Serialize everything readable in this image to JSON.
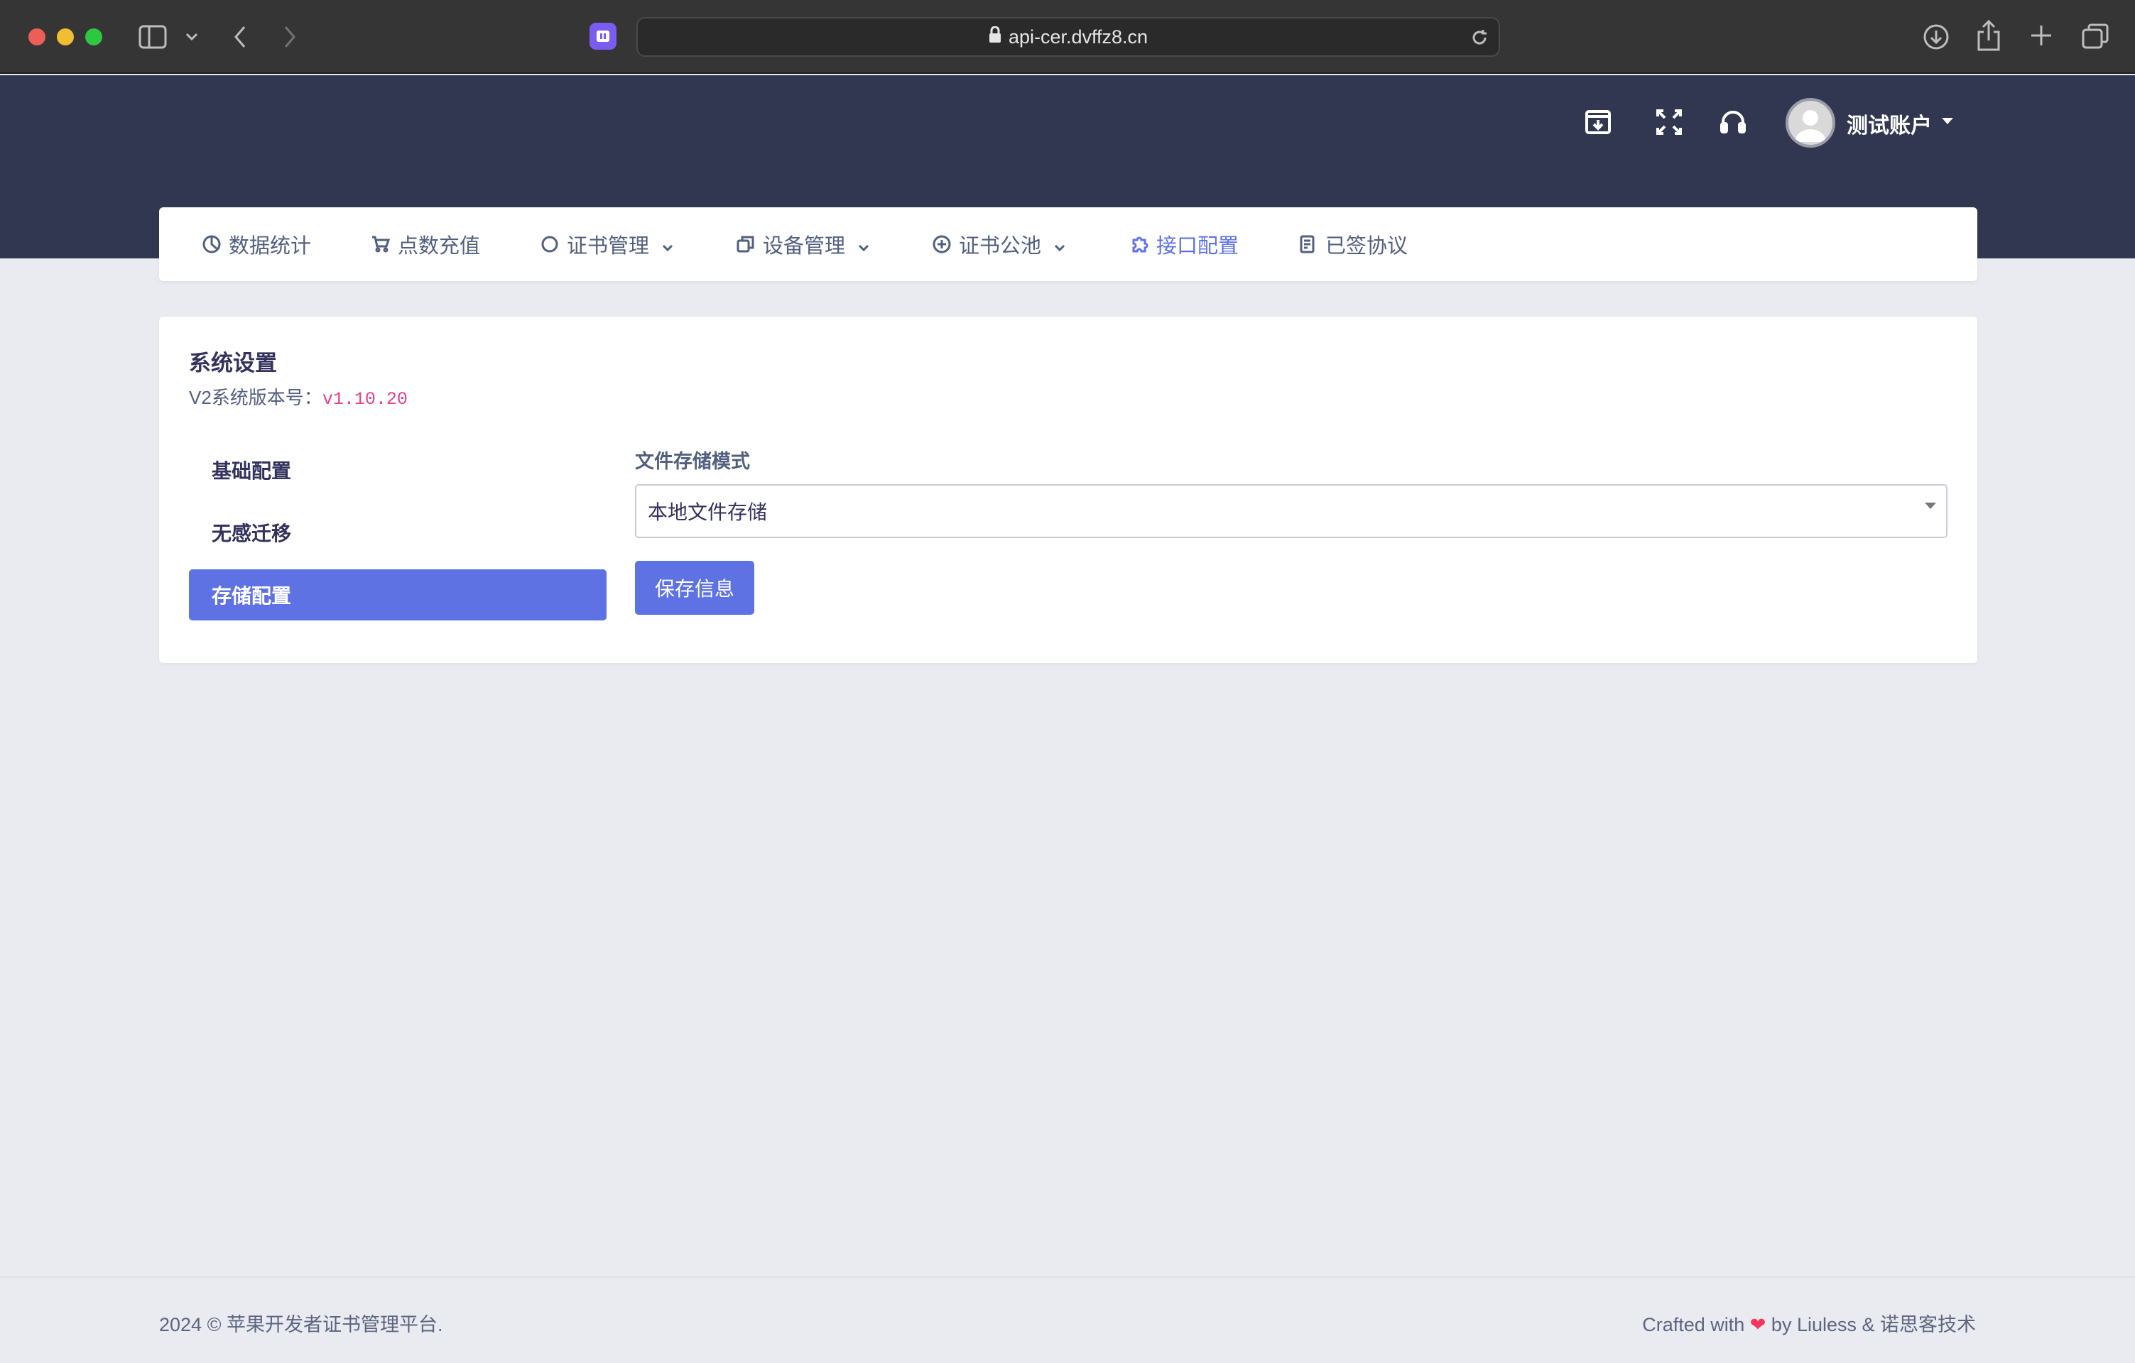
{
  "browser": {
    "url": "api-cer.dvffz8.cn",
    "icons": [
      "sidebar-toggle-icon",
      "chevron-down-icon",
      "back-icon",
      "forward-icon",
      "extension-icon",
      "lock-icon",
      "reload-icon",
      "download-icon",
      "share-icon",
      "new-tab-icon",
      "tab-overview-icon"
    ]
  },
  "header": {
    "icons": [
      "archive-download-icon",
      "fullscreen-icon",
      "headset-icon"
    ],
    "user_name": "测试账户"
  },
  "nav": {
    "items": [
      {
        "label": "数据统计",
        "icon": "pie-chart-icon",
        "dropdown": false,
        "active": false
      },
      {
        "label": "点数充值",
        "icon": "cart-icon",
        "dropdown": false,
        "active": false
      },
      {
        "label": "证书管理",
        "icon": "circle-icon",
        "dropdown": true,
        "active": false
      },
      {
        "label": "设备管理",
        "icon": "copy-icon",
        "dropdown": true,
        "active": false
      },
      {
        "label": "证书公池",
        "icon": "plus-circle-icon",
        "dropdown": true,
        "active": false
      },
      {
        "label": "接口配置",
        "icon": "puzzle-icon",
        "dropdown": false,
        "active": true
      },
      {
        "label": "已签协议",
        "icon": "document-icon",
        "dropdown": false,
        "active": false
      }
    ]
  },
  "card": {
    "title": "系统设置",
    "version_label": "V2系统版本号：",
    "version_value": "v1.10.20",
    "side_menu": [
      "基础配置",
      "无感迁移",
      "存储配置"
    ],
    "active_side": "存储配置",
    "field_label": "文件存储模式",
    "select_value": "本地文件存储",
    "save_label": "保存信息"
  },
  "footer": {
    "left": "2024 © 苹果开发者证书管理平台.",
    "right_prefix": "Crafted with",
    "right_suffix": "by Liuless & 诺思客技术"
  },
  "colors": {
    "header_bg": "#313751",
    "accent": "#5e72e4",
    "page_bg": "#eaebf0",
    "version_code": "#e83e8c"
  }
}
